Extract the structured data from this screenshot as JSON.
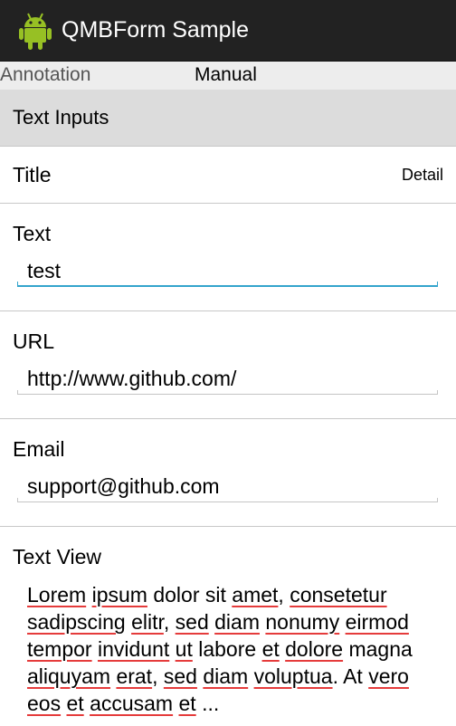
{
  "app": {
    "title": "QMBForm Sample",
    "icon": "android-robot-icon",
    "actionbar_color": "#222222"
  },
  "tabs": [
    "Annotation",
    "Manual"
  ],
  "section": {
    "title": "Text Inputs"
  },
  "title_row": {
    "label": "Title",
    "value": "Detail"
  },
  "fields": [
    {
      "label": "Text",
      "value": "test",
      "focused": true
    },
    {
      "label": "URL",
      "value": "http://www.github.com/"
    },
    {
      "label": "Email",
      "value": "support@github.com"
    }
  ],
  "text_view": {
    "label": "Text View",
    "value": "Lorem ipsum dolor sit amet, consetetur sadipscing elitr, sed diam nonumy eirmod tempor invidunt ut labore et dolore magna aliquyam erat, sed diam voluptua. At vero eos et accusam et ..."
  },
  "colors": {
    "focus_underline": "#33a4cc",
    "spellcheck": "#e53b3b"
  }
}
